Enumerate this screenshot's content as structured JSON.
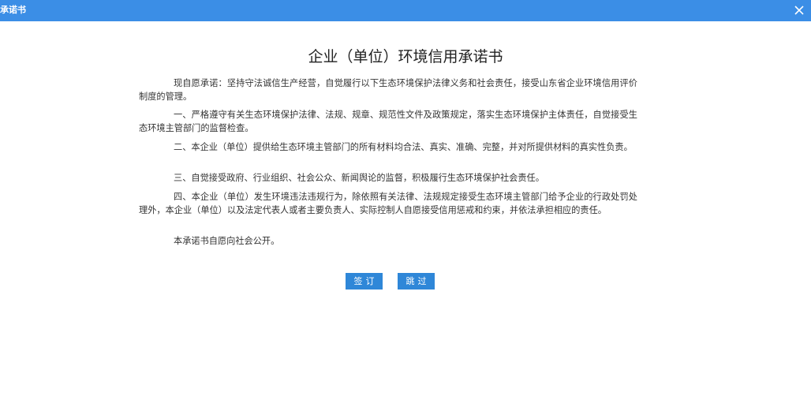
{
  "window": {
    "title": "承诺书",
    "close_icon": "close-icon"
  },
  "document": {
    "title": "企业（单位）环境信用承诺书",
    "paragraphs": [
      "现自愿承诺：坚持守法诚信生产经营，自觉履行以下生态环境保护法律义务和社会责任，接受山东省企业环境信用评价制度的管理。",
      "一、严格遵守有关生态环境保护法律、法规、规章、规范性文件及政策规定，落实生态环境保护主体责任，自觉接受生态环境主管部门的监督检查。",
      "二、本企业（单位）提供给生态环境主管部门的所有材料均合法、真实、准确、完整，并对所提供材料的真实性负责。",
      "三、自觉接受政府、行业组织、社会公众、新闻舆论的监督，积极履行生态环境保护社会责任。",
      "四、本企业（单位）发生环境违法违规行为，除依照有关法律、法规规定接受生态环境主管部门给予企业的行政处罚处理外，本企业（单位）以及法定代表人或者主要负责人、实际控制人自愿接受信用惩戒和约束，并依法承担相应的责任。",
      "本承诺书自愿向社会公开。"
    ]
  },
  "buttons": {
    "sign_label": "签订",
    "skip_label": "跳过"
  },
  "colors": {
    "titlebar": "#3b8ee6",
    "button": "#2f87d8"
  }
}
